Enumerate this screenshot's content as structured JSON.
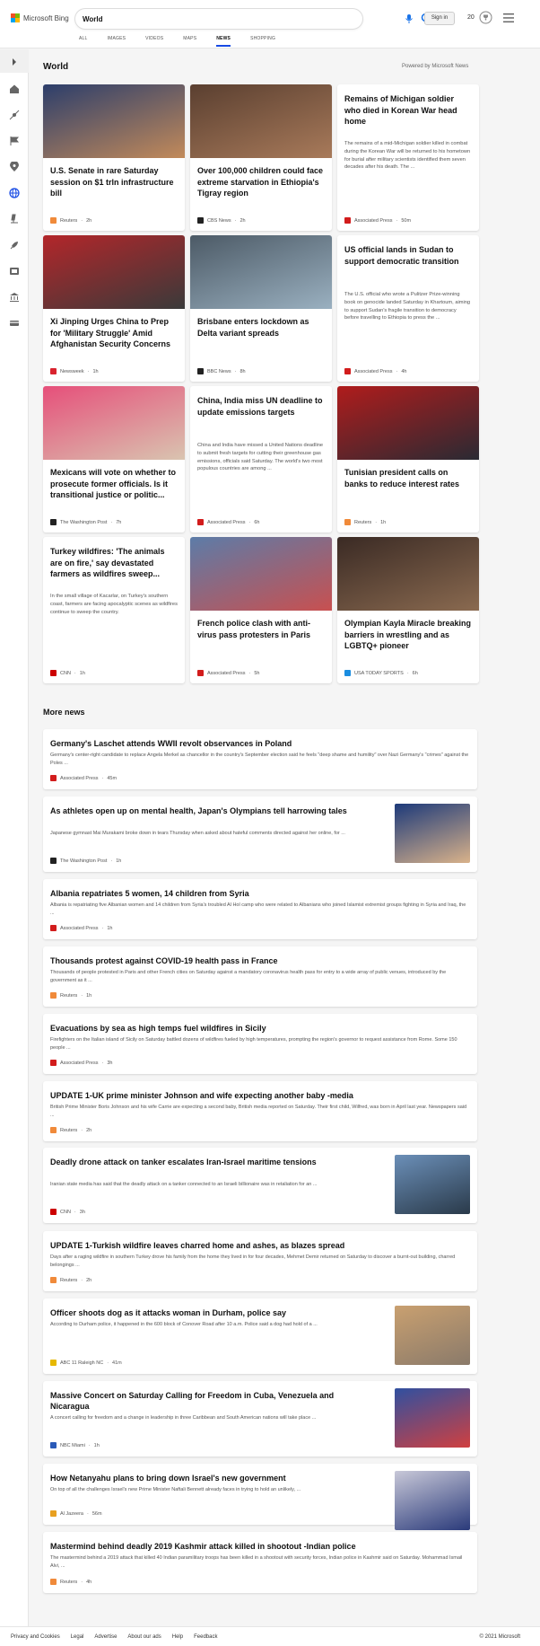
{
  "header": {
    "logo_text": "Microsoft Bing",
    "search_value": "World",
    "signin_label": "Sign in",
    "rewards_count": "20",
    "tabs": [
      {
        "label": "ALL"
      },
      {
        "label": "IMAGES"
      },
      {
        "label": "VIDEOS"
      },
      {
        "label": "MAPS"
      },
      {
        "label": "NEWS"
      },
      {
        "label": "SHOPPING"
      }
    ]
  },
  "section": {
    "title": "World",
    "powered_by": "Powered by Microsoft News"
  },
  "cards": [
    {
      "title": "U.S. Senate in rare Saturday session on $1 trln infrastructure bill",
      "snippet": "",
      "source": "Reuters",
      "age": "2h",
      "src_color": "#f08a3a",
      "img_colors": [
        "#2c3e6b",
        "#c28a5a"
      ]
    },
    {
      "title": "Over 100,000 children could face extreme starvation in Ethiopia's Tigray region",
      "snippet": "",
      "source": "CBS News",
      "age": "2h",
      "src_color": "#222222",
      "img_colors": [
        "#5a3f30",
        "#a87a5a"
      ]
    },
    {
      "title": "Remains of Michigan soldier who died in Korean War head home",
      "snippet": "The remains of a mid-Michigan soldier killed in combat during the Korean War will be returned to his hometown for burial after military scientists identified them seven decades after his death. The ...",
      "source": "Associated Press",
      "age": "50m",
      "src_color": "#d21c1c",
      "img_colors": []
    },
    {
      "title": "Xi Jinping Urges China to Prep for 'Military Struggle' Amid Afghanistan Security Concerns",
      "snippet": "",
      "source": "Newsweek",
      "age": "1h",
      "src_color": "#d9232e",
      "img_colors": [
        "#b3262a",
        "#3a3a3a"
      ]
    },
    {
      "title": "Brisbane enters lockdown as Delta variant spreads",
      "snippet": "",
      "source": "BBC News",
      "age": "8h",
      "src_color": "#222222",
      "img_colors": [
        "#4c5a66",
        "#9ab0c0"
      ]
    },
    {
      "title": "US official lands in Sudan to support democratic transition",
      "snippet": "The U.S. official who wrote a Pulitzer Prize-winning book on genocide landed Saturday in Khartoum, aiming to support Sudan's fragile transition to democracy before travelling to Ethiopia to press the ...",
      "source": "Associated Press",
      "age": "4h",
      "src_color": "#d21c1c",
      "img_colors": []
    },
    {
      "title": "Mexicans will vote on whether to prosecute former officials. Is it transitional justice or politic...",
      "snippet": "",
      "source": "The Washington Post",
      "age": "7h",
      "src_color": "#222222",
      "img_colors": [
        "#e64f7a",
        "#d9c4b0"
      ]
    },
    {
      "title": "China, India miss UN deadline to update emissions targets",
      "snippet": "China and India have missed a United Nations deadline to submit fresh targets for cutting their greenhouse gas emissions, officials said Saturday. The world's two most populous countries are among ...",
      "source": "Associated Press",
      "age": "6h",
      "src_color": "#d21c1c",
      "img_colors": []
    },
    {
      "title": "Tunisian president calls on banks to reduce interest rates",
      "snippet": "",
      "source": "Reuters",
      "age": "1h",
      "src_color": "#f08a3a",
      "img_colors": [
        "#b01c1c",
        "#2a2a33"
      ]
    },
    {
      "title": "Turkey wildfires: 'The animals are on fire,' say devastated farmers as wildfires sweep...",
      "snippet": "In the small village of Kacarlar, on Turkey's southern coast, farmers are facing apocalyptic scenes as wildfires continue to sweep the country.",
      "source": "CNN",
      "age": "1h",
      "src_color": "#cc0000",
      "img_colors": []
    },
    {
      "title": "French police clash with anti-virus pass protesters in Paris",
      "snippet": "",
      "source": "Associated Press",
      "age": "5h",
      "src_color": "#d21c1c",
      "img_colors": [
        "#5c7ca8",
        "#c85050"
      ]
    },
    {
      "title": "Olympian Kayla Miracle breaking barriers in wrestling and as LGBTQ+ pioneer",
      "snippet": "",
      "source": "USA TODAY SPORTS",
      "age": "6h",
      "src_color": "#1a8de0",
      "img_colors": [
        "#3a2a24",
        "#8a6a50"
      ]
    }
  ],
  "more_news": {
    "title": "More news",
    "items": [
      {
        "title": "Germany's Laschet attends WWII revolt observances in Poland",
        "snippet": "Germany's center-right candidate to replace Angela Merkel as chancellor in the country's September election said he feels \"deep shame and humility\" over Nazi Germany's \"crimes\" against the Poles ...",
        "source": "Associated Press",
        "age": "45m",
        "src_color": "#d21c1c",
        "thumb": false
      },
      {
        "title": "As athletes open up on mental health, Japan's Olympians tell harrowing tales",
        "snippet": "Japanese gymnast Mai Murakami broke down in tears Thursday when asked about hateful comments directed against her online, for ...",
        "source": "The Washington Post",
        "age": "1h",
        "src_color": "#222222",
        "thumb": true,
        "thumb_colors": [
          "#1d3a7a",
          "#d9b28a"
        ]
      },
      {
        "title": "Albania repatriates 5 women, 14 children from Syria",
        "snippet": "Albania is repatriating five Albanian women and 14 children from Syria's troubled Al Hol camp who were related to Albanians who joined Islamist extremist groups fighting in Syria and Iraq, the ...",
        "source": "Associated Press",
        "age": "1h",
        "src_color": "#d21c1c",
        "thumb": false
      },
      {
        "title": "Thousands protest against COVID-19 health pass in France",
        "snippet": "Thousands of people protested in Paris and other French cities on Saturday against a mandatory coronavirus health pass for entry to a wide array of public venues, introduced by the government as it ...",
        "source": "Reuters",
        "age": "1h",
        "src_color": "#f08a3a",
        "thumb": false
      },
      {
        "title": "Evacuations by sea as high temps fuel wildfires in Sicily",
        "snippet": "Firefighters on the Italian island of Sicily on Saturday battled dozens of wildfires fueled by high temperatures, prompting the region's governor to request assistance from Rome. Some 150 people ...",
        "source": "Associated Press",
        "age": "3h",
        "src_color": "#d21c1c",
        "thumb": false
      },
      {
        "title": "UPDATE 1-UK prime minister Johnson and wife expecting another baby -media",
        "snippet": "British Prime Minister Boris Johnson and his wife Carrie are expecting a second baby, British media reported on Saturday. Their first child, Wilfred, was born in April last year. Newspapers said ...",
        "source": "Reuters",
        "age": "2h",
        "src_color": "#f08a3a",
        "thumb": false
      },
      {
        "title": "Deadly drone attack on tanker escalates Iran-Israel maritime tensions",
        "snippet": "Iranian state media has said that the deadly attack on a tanker connected to an Israeli billionaire was in retaliation for an ...",
        "source": "CNN",
        "age": "3h",
        "src_color": "#cc0000",
        "thumb": true,
        "thumb_colors": [
          "#6b8fb8",
          "#2a3a4a"
        ]
      },
      {
        "title": "UPDATE 1-Turkish wildfire leaves charred home and ashes, as blazes spread",
        "snippet": "Days after a raging wildfire in southern Turkey drove his family from the home they lived in for four decades, Mehmet Demir returned on Saturday to discover a burnt-out building, charred belongings ...",
        "source": "Reuters",
        "age": "2h",
        "src_color": "#f08a3a",
        "thumb": false
      },
      {
        "title": "Officer shoots dog as it attacks woman in Durham, police say",
        "snippet": "According to Durham police, it happened in the 600 block of Conover Road after 10 a.m. Police said a dog had hold of a ...",
        "source": "ABC 11 Raleigh NC",
        "age": "41m",
        "src_color": "#e6b800",
        "thumb": true,
        "thumb_colors": [
          "#c9a070",
          "#8a7a6a"
        ]
      },
      {
        "title": "Massive Concert on Saturday Calling for Freedom in Cuba, Venezuela and Nicaragua",
        "snippet": "A concert calling for freedom and a change in leadership in three Caribbean and South American nations will take place ...",
        "source": "NBC Miami",
        "age": "1h",
        "src_color": "#2a5ab8",
        "thumb": true,
        "thumb_colors": [
          "#3050a0",
          "#d04040"
        ]
      },
      {
        "title": "How Netanyahu plans to bring down Israel's new government",
        "snippet": "On top of all the challenges Israel's new Prime Minister Naftali Bennett already faces in trying to hold an unlikely, ...",
        "source": "Al Jazeera",
        "age": "56m",
        "src_color": "#e8a020",
        "thumb": true,
        "thumb_colors": [
          "#c8c8d8",
          "#2a3a7a"
        ]
      },
      {
        "title": "Mastermind behind deadly 2019 Kashmir attack killed in shootout -Indian police",
        "snippet": "The mastermind behind a 2019 attack that killed 40 Indian paramilitary troops has been killed in a shootout with security forces, Indian police in Kashmir said on Saturday. Mohammad Ismail Alvi, ...",
        "source": "Reuters",
        "age": "4h",
        "src_color": "#f08a3a",
        "thumb": false
      }
    ]
  },
  "footer": {
    "links": [
      "Privacy and Cookies",
      "Legal",
      "Advertise",
      "About our ads",
      "Help",
      "Feedback"
    ],
    "copyright": "© 2021 Microsoft"
  },
  "colors": {
    "accent": "#174ae4",
    "background": "#f5f5f5"
  }
}
